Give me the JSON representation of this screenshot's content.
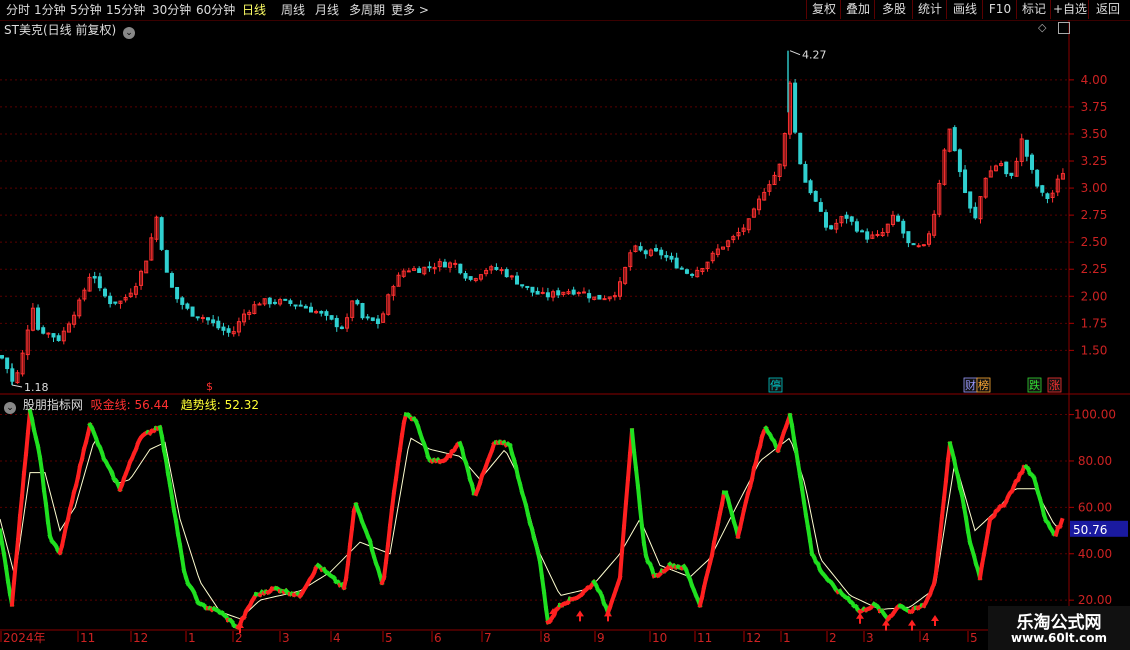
{
  "toolbar": {
    "periods": [
      "分时",
      "1分钟",
      "5分钟",
      "15分钟",
      "30分钟",
      "60分钟",
      "日线",
      "周线",
      "月线",
      "多周期",
      "更多 >"
    ],
    "active": "日线",
    "right_buttons": [
      "复权",
      "叠加",
      "多股",
      "统计",
      "画线",
      "F10",
      "标记",
      "+自选",
      "返回"
    ]
  },
  "stock": {
    "title": "ST美克(日线 前复权)"
  },
  "indicator": {
    "name": "股朋指标网",
    "line1_label": "吸金线:",
    "line1_value": "56.44",
    "line2_label": "趋势线:",
    "line2_value": "52.32",
    "current_value": "50.76"
  },
  "markers": {
    "max_label": "4.27",
    "min_label": "1.18",
    "dividend": "$"
  },
  "badges": [
    {
      "text": "停",
      "color": "#00c8c8"
    },
    {
      "text": "财",
      "color": "#9999ff"
    },
    {
      "text": "榜",
      "color": "#ffaa33"
    },
    {
      "text": "跌",
      "color": "#33dd33"
    },
    {
      "text": "涨",
      "color": "#ff3333"
    }
  ],
  "watermark": {
    "line1": "乐淘公式网",
    "line2": "www.60lt.com"
  },
  "colors": {
    "up": "#ff3030",
    "down": "#30d0d0",
    "grid": "#5a0000",
    "axis_text": "#cc2222",
    "osc_up": "#ff2020",
    "osc_down": "#20e020",
    "trend": "#ffffd0",
    "highlight_box": "#1a1aa0"
  },
  "chart_data": [
    {
      "type": "candlestick",
      "title": "ST美克(日线 前复权)",
      "ylim": [
        1.18,
        4.35
      ],
      "yticks": [
        1.5,
        1.75,
        2.0,
        2.25,
        2.5,
        2.75,
        3.0,
        3.25,
        3.5,
        3.75,
        4.0
      ],
      "ytick_labels": [
        "1.50",
        "1.75",
        "2.00",
        "2.25",
        "2.50",
        "2.75",
        "3.00",
        "3.25",
        "3.50",
        "3.75",
        "4.00"
      ],
      "max": 4.27,
      "min": 1.18,
      "price_path": [
        [
          0,
          1.45
        ],
        [
          5,
          1.4
        ],
        [
          10,
          1.25
        ],
        [
          14,
          1.18
        ],
        [
          18,
          1.3
        ],
        [
          25,
          1.55
        ],
        [
          32,
          1.95
        ],
        [
          38,
          1.7
        ],
        [
          50,
          1.65
        ],
        [
          60,
          1.6
        ],
        [
          68,
          1.75
        ],
        [
          80,
          1.95
        ],
        [
          92,
          2.25
        ],
        [
          100,
          2.05
        ],
        [
          110,
          1.95
        ],
        [
          122,
          1.95
        ],
        [
          135,
          2.1
        ],
        [
          145,
          2.3
        ],
        [
          157,
          2.75
        ],
        [
          165,
          2.25
        ],
        [
          175,
          2.0
        ],
        [
          190,
          1.85
        ],
        [
          205,
          1.8
        ],
        [
          220,
          1.7
        ],
        [
          232,
          1.65
        ],
        [
          245,
          1.85
        ],
        [
          260,
          1.95
        ],
        [
          280,
          1.95
        ],
        [
          300,
          1.92
        ],
        [
          318,
          1.85
        ],
        [
          335,
          1.75
        ],
        [
          345,
          1.7
        ],
        [
          353,
          2.0
        ],
        [
          362,
          1.8
        ],
        [
          380,
          1.75
        ],
        [
          392,
          2.1
        ],
        [
          405,
          2.25
        ],
        [
          420,
          2.25
        ],
        [
          440,
          2.3
        ],
        [
          455,
          2.3
        ],
        [
          470,
          2.15
        ],
        [
          485,
          2.25
        ],
        [
          500,
          2.25
        ],
        [
          515,
          2.15
        ],
        [
          530,
          2.05
        ],
        [
          545,
          2.0
        ],
        [
          565,
          2.05
        ],
        [
          580,
          2.05
        ],
        [
          595,
          1.98
        ],
        [
          608,
          2.0
        ],
        [
          618,
          2.05
        ],
        [
          632,
          2.45
        ],
        [
          645,
          2.4
        ],
        [
          660,
          2.4
        ],
        [
          675,
          2.3
        ],
        [
          690,
          2.2
        ],
        [
          705,
          2.3
        ],
        [
          720,
          2.45
        ],
        [
          735,
          2.55
        ],
        [
          750,
          2.7
        ],
        [
          765,
          3.0
        ],
        [
          777,
          3.15
        ],
        [
          784,
          3.3
        ],
        [
          788,
          4.27
        ],
        [
          792,
          3.7
        ],
        [
          797,
          3.4
        ],
        [
          803,
          3.1
        ],
        [
          812,
          2.95
        ],
        [
          828,
          2.6
        ],
        [
          845,
          2.75
        ],
        [
          865,
          2.55
        ],
        [
          880,
          2.55
        ],
        [
          895,
          2.75
        ],
        [
          910,
          2.45
        ],
        [
          925,
          2.45
        ],
        [
          935,
          2.8
        ],
        [
          945,
          3.4
        ],
        [
          950,
          3.55
        ],
        [
          960,
          3.15
        ],
        [
          968,
          2.85
        ],
        [
          975,
          2.7
        ],
        [
          985,
          3.1
        ],
        [
          1000,
          3.25
        ],
        [
          1010,
          3.05
        ],
        [
          1022,
          3.45
        ],
        [
          1030,
          3.2
        ],
        [
          1040,
          2.95
        ],
        [
          1050,
          2.9
        ],
        [
          1062,
          3.15
        ]
      ]
    },
    {
      "type": "line",
      "title": "股朋指标网",
      "ylim": [
        8,
        108
      ],
      "yticks": [
        20,
        40,
        60,
        80,
        100
      ],
      "ytick_labels": [
        "20.00",
        "40.00",
        "60.00",
        "80.00",
        "100.00"
      ],
      "series": [
        {
          "name": "吸金线",
          "points": [
            [
              0,
              50
            ],
            [
              12,
              18
            ],
            [
              22,
              65
            ],
            [
              30,
              102
            ],
            [
              40,
              82
            ],
            [
              50,
              47
            ],
            [
              60,
              40
            ],
            [
              75,
              68
            ],
            [
              90,
              96
            ],
            [
              105,
              80
            ],
            [
              120,
              68
            ],
            [
              140,
              90
            ],
            [
              160,
              95
            ],
            [
              170,
              70
            ],
            [
              185,
              30
            ],
            [
              200,
              18
            ],
            [
              220,
              15
            ],
            [
              238,
              8
            ],
            [
              255,
              22
            ],
            [
              275,
              25
            ],
            [
              300,
              22
            ],
            [
              318,
              35
            ],
            [
              345,
              25
            ],
            [
              355,
              62
            ],
            [
              368,
              48
            ],
            [
              383,
              26
            ],
            [
              395,
              70
            ],
            [
              405,
              100
            ],
            [
              415,
              98
            ],
            [
              430,
              80
            ],
            [
              445,
              80
            ],
            [
              460,
              88
            ],
            [
              475,
              65
            ],
            [
              495,
              88
            ],
            [
              510,
              87
            ],
            [
              525,
              62
            ],
            [
              540,
              37
            ],
            [
              548,
              10
            ],
            [
              560,
              18
            ],
            [
              580,
              22
            ],
            [
              595,
              28
            ],
            [
              608,
              15
            ],
            [
              620,
              30
            ],
            [
              632,
              93
            ],
            [
              645,
              40
            ],
            [
              655,
              30
            ],
            [
              670,
              35
            ],
            [
              685,
              34
            ],
            [
              700,
              18
            ],
            [
              712,
              40
            ],
            [
              725,
              68
            ],
            [
              738,
              48
            ],
            [
              755,
              78
            ],
            [
              765,
              95
            ],
            [
              778,
              85
            ],
            [
              790,
              100
            ],
            [
              800,
              74
            ],
            [
              812,
              40
            ],
            [
              822,
              32
            ],
            [
              835,
              25
            ],
            [
              850,
              20
            ],
            [
              860,
              15
            ],
            [
              875,
              18
            ],
            [
              888,
              12
            ],
            [
              900,
              18
            ],
            [
              910,
              15
            ],
            [
              925,
              18
            ],
            [
              935,
              28
            ],
            [
              950,
              88
            ],
            [
              962,
              65
            ],
            [
              970,
              45
            ],
            [
              980,
              30
            ],
            [
              990,
              55
            ],
            [
              1005,
              62
            ],
            [
              1015,
              70
            ],
            [
              1025,
              78
            ],
            [
              1035,
              72
            ],
            [
              1045,
              55
            ],
            [
              1055,
              48
            ],
            [
              1063,
              55
            ]
          ]
        },
        {
          "name": "趋势线",
          "points": [
            [
              0,
              55
            ],
            [
              15,
              30
            ],
            [
              30,
              75
            ],
            [
              45,
              75
            ],
            [
              60,
              50
            ],
            [
              75,
              60
            ],
            [
              95,
              90
            ],
            [
              115,
              70
            ],
            [
              130,
              72
            ],
            [
              150,
              85
            ],
            [
              165,
              88
            ],
            [
              180,
              55
            ],
            [
              200,
              28
            ],
            [
              220,
              15
            ],
            [
              240,
              12
            ],
            [
              260,
              20
            ],
            [
              300,
              24
            ],
            [
              330,
              32
            ],
            [
              360,
              45
            ],
            [
              390,
              40
            ],
            [
              410,
              90
            ],
            [
              430,
              85
            ],
            [
              460,
              82
            ],
            [
              480,
              72
            ],
            [
              505,
              85
            ],
            [
              520,
              72
            ],
            [
              540,
              40
            ],
            [
              560,
              22
            ],
            [
              590,
              25
            ],
            [
              620,
              40
            ],
            [
              640,
              55
            ],
            [
              660,
              35
            ],
            [
              690,
              30
            ],
            [
              710,
              38
            ],
            [
              730,
              55
            ],
            [
              760,
              80
            ],
            [
              790,
              90
            ],
            [
              805,
              70
            ],
            [
              820,
              38
            ],
            [
              850,
              22
            ],
            [
              880,
              16
            ],
            [
              910,
              17
            ],
            [
              935,
              25
            ],
            [
              955,
              80
            ],
            [
              975,
              50
            ],
            [
              995,
              58
            ],
            [
              1015,
              68
            ],
            [
              1035,
              68
            ],
            [
              1055,
              52
            ],
            [
              1063,
              52
            ]
          ]
        }
      ]
    }
  ],
  "x_axis": {
    "labels": [
      {
        "text": "2024年",
        "x": 3
      },
      {
        "text": "11",
        "x": 80
      },
      {
        "text": "12",
        "x": 133
      },
      {
        "text": "1",
        "x": 188
      },
      {
        "text": "2",
        "x": 235
      },
      {
        "text": "3",
        "x": 282
      },
      {
        "text": "4",
        "x": 333
      },
      {
        "text": "5",
        "x": 385
      },
      {
        "text": "6",
        "x": 434
      },
      {
        "text": "7",
        "x": 484
      },
      {
        "text": "8",
        "x": 543
      },
      {
        "text": "9",
        "x": 597
      },
      {
        "text": "10",
        "x": 652
      },
      {
        "text": "11",
        "x": 697
      },
      {
        "text": "12",
        "x": 746
      },
      {
        "text": "1",
        "x": 783
      },
      {
        "text": "2",
        "x": 829
      },
      {
        "text": "3",
        "x": 866
      },
      {
        "text": "4",
        "x": 922
      },
      {
        "text": "5",
        "x": 970
      }
    ]
  }
}
